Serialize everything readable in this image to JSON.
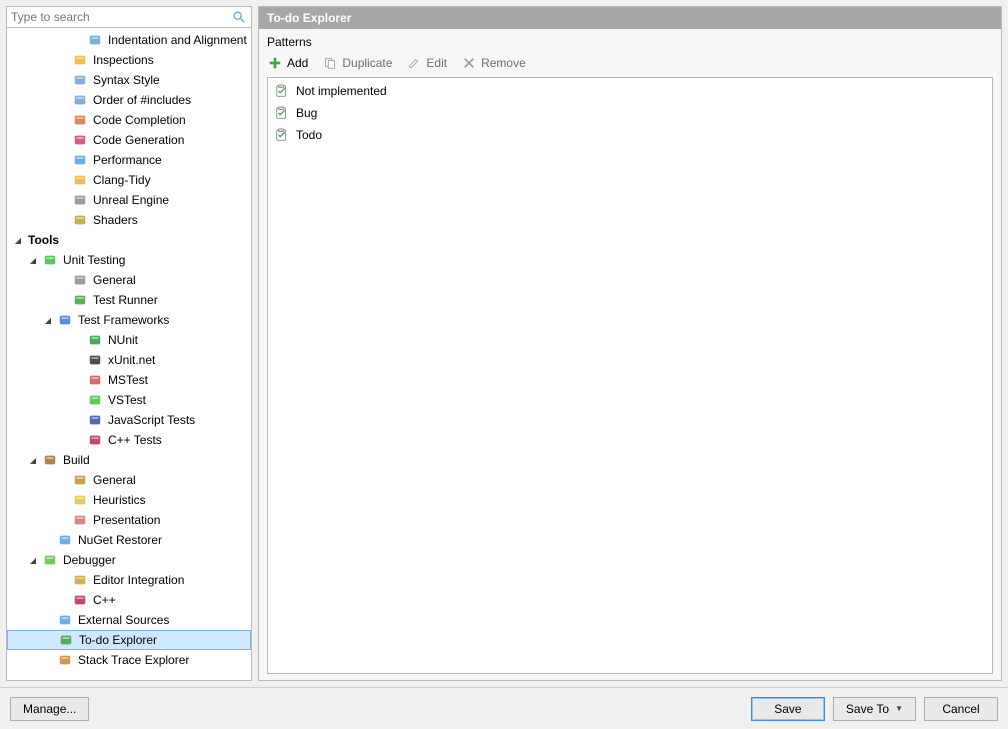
{
  "search": {
    "placeholder": "Type to search"
  },
  "tree": [
    {
      "indent": 4,
      "expander": "",
      "iconcolor": "#5aa3d8",
      "label": "Indentation and Alignment"
    },
    {
      "indent": 3,
      "expander": "",
      "iconcolor": "#f0b030",
      "label": "Inspections"
    },
    {
      "indent": 3,
      "expander": "",
      "iconcolor": "#6fa0d8",
      "label": "Syntax Style"
    },
    {
      "indent": 3,
      "expander": "",
      "iconcolor": "#6fa0d8",
      "label": "Order of #includes"
    },
    {
      "indent": 3,
      "expander": "",
      "iconcolor": "#e07030",
      "label": "Code Completion"
    },
    {
      "indent": 3,
      "expander": "",
      "iconcolor": "#d04070",
      "label": "Code Generation"
    },
    {
      "indent": 3,
      "expander": "",
      "iconcolor": "#50a0e0",
      "label": "Performance"
    },
    {
      "indent": 3,
      "expander": "",
      "iconcolor": "#f0b030",
      "label": "Clang-Tidy"
    },
    {
      "indent": 3,
      "expander": "",
      "iconcolor": "#888888",
      "label": "Unreal Engine"
    },
    {
      "indent": 3,
      "expander": "",
      "iconcolor": "#c0a030",
      "label": "Shaders"
    },
    {
      "indent": 0,
      "expander": "▾",
      "iconcolor": "",
      "label": "Tools",
      "bold": true
    },
    {
      "indent": 1,
      "expander": "▾",
      "iconcolor": "#40c040",
      "label": "Unit Testing"
    },
    {
      "indent": 3,
      "expander": "",
      "iconcolor": "#888888",
      "label": "General"
    },
    {
      "indent": 3,
      "expander": "",
      "iconcolor": "#40a040",
      "label": "Test Runner"
    },
    {
      "indent": 2,
      "expander": "▾",
      "iconcolor": "#4078d0",
      "label": "Test Frameworks"
    },
    {
      "indent": 4,
      "expander": "",
      "iconcolor": "#20a040",
      "label": "NUnit"
    },
    {
      "indent": 4,
      "expander": "",
      "iconcolor": "#303030",
      "label": "xUnit.net"
    },
    {
      "indent": 4,
      "expander": "",
      "iconcolor": "#d05050",
      "label": "MSTest"
    },
    {
      "indent": 4,
      "expander": "",
      "iconcolor": "#40c040",
      "label": "VSTest"
    },
    {
      "indent": 4,
      "expander": "",
      "iconcolor": "#3050a0",
      "label": "JavaScript Tests"
    },
    {
      "indent": 4,
      "expander": "",
      "iconcolor": "#c02060",
      "label": "C++ Tests"
    },
    {
      "indent": 1,
      "expander": "▾",
      "iconcolor": "#a07030",
      "label": "Build"
    },
    {
      "indent": 3,
      "expander": "",
      "iconcolor": "#c09030",
      "label": "General"
    },
    {
      "indent": 3,
      "expander": "",
      "iconcolor": "#e0c040",
      "label": "Heuristics"
    },
    {
      "indent": 3,
      "expander": "",
      "iconcolor": "#d07070",
      "label": "Presentation"
    },
    {
      "indent": 2,
      "expander": "",
      "iconcolor": "#50a0e0",
      "label": "NuGet Restorer"
    },
    {
      "indent": 1,
      "expander": "▾",
      "iconcolor": "#60c040",
      "label": "Debugger"
    },
    {
      "indent": 3,
      "expander": "",
      "iconcolor": "#d0a030",
      "label": "Editor Integration"
    },
    {
      "indent": 3,
      "expander": "",
      "iconcolor": "#c02060",
      "label": "C++"
    },
    {
      "indent": 2,
      "expander": "",
      "iconcolor": "#50a0e0",
      "label": "External Sources"
    },
    {
      "indent": 2,
      "expander": "",
      "iconcolor": "#40a040",
      "label": "To-do Explorer",
      "selected": true
    },
    {
      "indent": 2,
      "expander": "",
      "iconcolor": "#d08030",
      "label": "Stack Trace Explorer"
    }
  ],
  "panel": {
    "title": "To-do Explorer",
    "section_label": "Patterns",
    "toolbar": {
      "add": "Add",
      "duplicate": "Duplicate",
      "edit": "Edit",
      "remove": "Remove"
    },
    "items": [
      {
        "label": "Not implemented"
      },
      {
        "label": "Bug"
      },
      {
        "label": "Todo"
      }
    ]
  },
  "footer": {
    "manage": "Manage...",
    "save": "Save",
    "saveTo": "Save To",
    "cancel": "Cancel"
  }
}
